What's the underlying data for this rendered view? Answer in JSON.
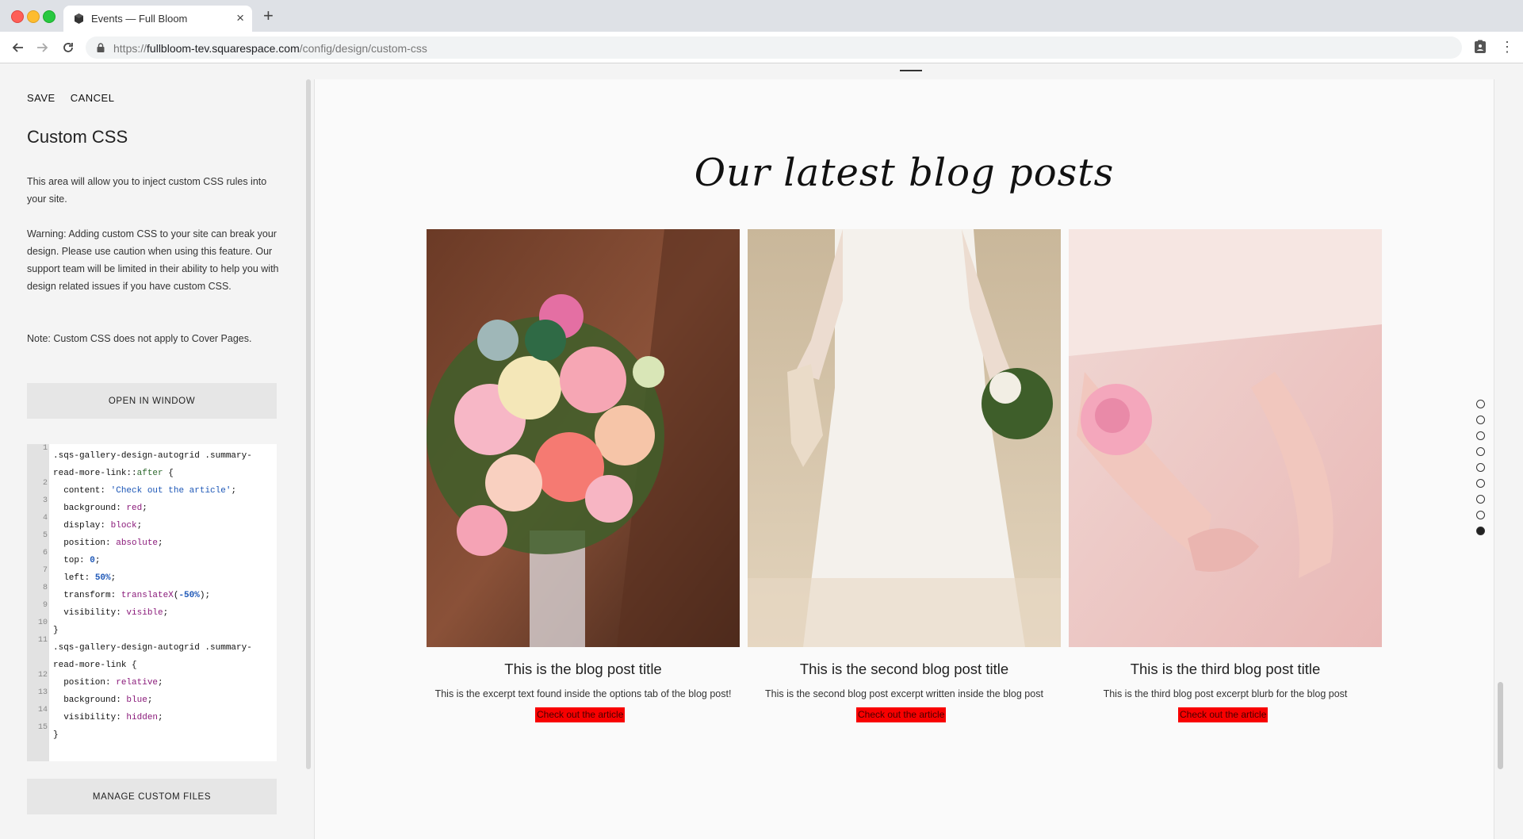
{
  "browser": {
    "tab_title": "Events — Full Bloom",
    "url_scheme": "https://",
    "url_host": "fullbloom-tev.squarespace.com",
    "url_path": "/config/design/custom-css"
  },
  "panel": {
    "save_label": "SAVE",
    "cancel_label": "CANCEL",
    "title": "Custom CSS",
    "intro": "This area will allow you to inject custom CSS rules into your site.",
    "warning": "Warning: Adding custom CSS to your site can break your design. Please use caution when using this feature. Our support team will be limited in their ability to help you with design related issues if you have custom CSS.",
    "note": "Note: Custom CSS does not apply to Cover Pages.",
    "open_window_label": "OPEN IN WINDOW",
    "manage_files_label": "MANAGE CUSTOM FILES",
    "code_lines": [
      {
        "n": "1",
        "parts": [
          {
            "t": ".sqs-gallery-design-autogrid .summary-",
            "c": ""
          }
        ]
      },
      {
        "n": "",
        "parts": [
          {
            "t": "read-more-link::",
            "c": ""
          },
          {
            "t": "after",
            "c": "c-kw"
          },
          {
            "t": " {",
            "c": ""
          }
        ]
      },
      {
        "n": "2",
        "parts": [
          {
            "t": "  content: ",
            "c": ""
          },
          {
            "t": "'Check out the article'",
            "c": "c-str"
          },
          {
            "t": ";",
            "c": ""
          }
        ]
      },
      {
        "n": "3",
        "parts": [
          {
            "t": "  background: ",
            "c": ""
          },
          {
            "t": "red",
            "c": "c-val"
          },
          {
            "t": ";",
            "c": ""
          }
        ]
      },
      {
        "n": "4",
        "parts": [
          {
            "t": "  display: ",
            "c": ""
          },
          {
            "t": "block",
            "c": "c-val"
          },
          {
            "t": ";",
            "c": ""
          }
        ]
      },
      {
        "n": "5",
        "parts": [
          {
            "t": "  position: ",
            "c": ""
          },
          {
            "t": "absolute",
            "c": "c-val"
          },
          {
            "t": ";",
            "c": ""
          }
        ]
      },
      {
        "n": "6",
        "parts": [
          {
            "t": "  top: ",
            "c": ""
          },
          {
            "t": "0",
            "c": "c-num"
          },
          {
            "t": ";",
            "c": ""
          }
        ]
      },
      {
        "n": "7",
        "parts": [
          {
            "t": "  left: ",
            "c": ""
          },
          {
            "t": "50%",
            "c": "c-num"
          },
          {
            "t": ";",
            "c": ""
          }
        ]
      },
      {
        "n": "8",
        "parts": [
          {
            "t": "  transform: ",
            "c": ""
          },
          {
            "t": "translateX",
            "c": "c-val"
          },
          {
            "t": "(",
            "c": ""
          },
          {
            "t": "-50%",
            "c": "c-num"
          },
          {
            "t": ");",
            "c": ""
          }
        ]
      },
      {
        "n": "9",
        "parts": [
          {
            "t": "  visibility: ",
            "c": ""
          },
          {
            "t": "visible",
            "c": "c-val"
          },
          {
            "t": ";",
            "c": ""
          }
        ]
      },
      {
        "n": "10",
        "parts": [
          {
            "t": "}",
            "c": ""
          }
        ]
      },
      {
        "n": "11",
        "parts": [
          {
            "t": ".sqs-gallery-design-autogrid .summary-",
            "c": ""
          }
        ]
      },
      {
        "n": "",
        "parts": [
          {
            "t": "read-more-link {",
            "c": ""
          }
        ]
      },
      {
        "n": "12",
        "parts": [
          {
            "t": "  position: ",
            "c": ""
          },
          {
            "t": "relative",
            "c": "c-val"
          },
          {
            "t": ";",
            "c": ""
          }
        ]
      },
      {
        "n": "13",
        "parts": [
          {
            "t": "  background: ",
            "c": ""
          },
          {
            "t": "blue",
            "c": "c-val"
          },
          {
            "t": ";",
            "c": ""
          }
        ]
      },
      {
        "n": "14",
        "parts": [
          {
            "t": "  visibility: ",
            "c": ""
          },
          {
            "t": "hidden",
            "c": "c-val"
          },
          {
            "t": ";",
            "c": ""
          }
        ]
      },
      {
        "n": "15",
        "parts": [
          {
            "t": "}",
            "c": ""
          }
        ]
      }
    ]
  },
  "preview": {
    "heading": "Our latest blog posts",
    "posts": [
      {
        "title": "This is the blog post title",
        "excerpt": "This is the excerpt text found inside the options tab of the blog post!",
        "link": "Check out the article"
      },
      {
        "title": "This is the second blog post title",
        "excerpt": "This is the second blog post excerpt written inside the blog post",
        "link": "Check out the article"
      },
      {
        "title": "This is the third blog post title",
        "excerpt": "This is the third blog post excerpt blurb for the blog post",
        "link": "Check out the article"
      }
    ],
    "section_dots": 9,
    "active_dot_index": 8
  },
  "colors": {
    "link_bg": "#f80000",
    "panel_bg": "#f4f4f4",
    "preview_bg": "#fafafa"
  }
}
